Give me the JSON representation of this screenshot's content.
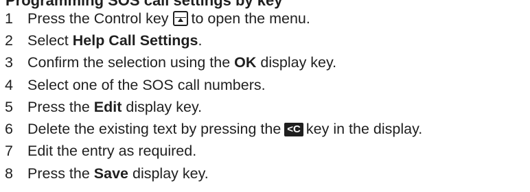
{
  "title": "Programming SOS call settings by key",
  "steps": [
    {
      "number": "1",
      "text_before": "Press the Control key",
      "icon": "control-key-icon",
      "text_after": "to open the menu."
    },
    {
      "number": "2",
      "text_before": "Select ",
      "bold": "Help Call Settings",
      "text_after": "."
    },
    {
      "number": "3",
      "text_before": "Confirm the selection using the ",
      "bold": "OK",
      "text_after": " display key."
    },
    {
      "number": "4",
      "text": "Select one of the SOS call numbers."
    },
    {
      "number": "5",
      "text_before": "Press the ",
      "bold": "Edit",
      "text_after": " display key."
    },
    {
      "number": "6",
      "text_before": "Delete the existing text by pressing the",
      "key_label": "<C",
      "text_after": "key in the display."
    },
    {
      "number": "7",
      "text": "Edit the entry as required."
    },
    {
      "number": "8",
      "text_before": "Press the ",
      "bold": "Save",
      "text_after": " display key."
    }
  ]
}
